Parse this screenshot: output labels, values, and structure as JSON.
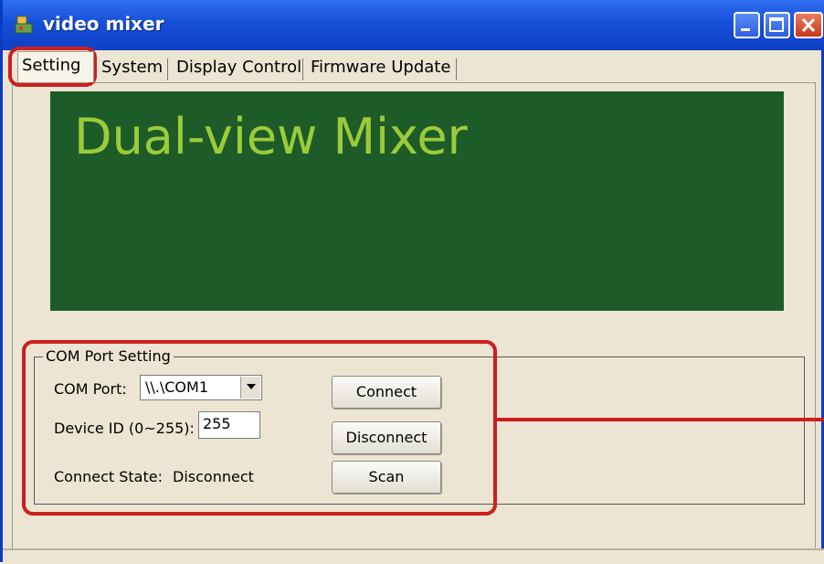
{
  "window": {
    "title": "video mixer"
  },
  "tabs": [
    {
      "label": "Setting",
      "active": true
    },
    {
      "label": "System",
      "active": false
    },
    {
      "label": "Display Control",
      "active": false
    },
    {
      "label": "Firmware Update",
      "active": false
    }
  ],
  "banner": {
    "text": "Dual-view Mixer",
    "bg_color": "#1d5c28",
    "text_color": "#9ccb3a"
  },
  "com_port_group": {
    "legend": "COM Port Setting",
    "com_port_label": "COM Port:",
    "com_port_value": "\\\\.\\COM1",
    "device_id_label": "Device ID (0~255):",
    "device_id_value": "255",
    "connect_state_label": "Connect State:",
    "connect_state_value": "Disconnect",
    "buttons": {
      "connect": "Connect",
      "disconnect": "Disconnect",
      "scan": "Scan"
    }
  },
  "colors": {
    "titlebar": "#1750d8",
    "annotation": "#cc1f1f",
    "dialog_bg": "#ece5d3"
  }
}
